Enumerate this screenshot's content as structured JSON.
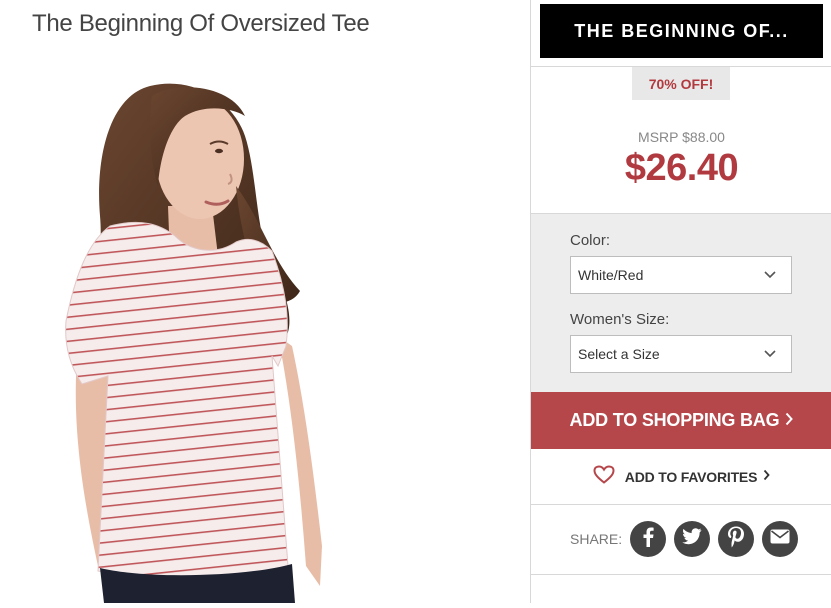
{
  "product": {
    "title": "The Beginning Of Oversized Tee",
    "image_alt": "Model wearing white and red striped oversized tee"
  },
  "brand": {
    "banner_text": "THE BEGINNING OF..."
  },
  "pricing": {
    "discount_badge": "70% OFF!",
    "msrp": "MSRP $88.00",
    "sale_price": "$26.40"
  },
  "options": {
    "color_label": "Color:",
    "color_value": "White/Red",
    "size_label": "Women's Size:",
    "size_value": "Select a Size"
  },
  "actions": {
    "add_to_bag": "ADD TO SHOPPING BAG",
    "add_to_favorites": "ADD TO FAVORITES"
  },
  "share": {
    "label": "SHARE:",
    "networks": [
      "facebook",
      "twitter",
      "pinterest",
      "email"
    ]
  },
  "colors": {
    "accent": "#b03a3f",
    "button": "#b5474b",
    "banner": "#000000",
    "icon_bg": "#444444"
  }
}
